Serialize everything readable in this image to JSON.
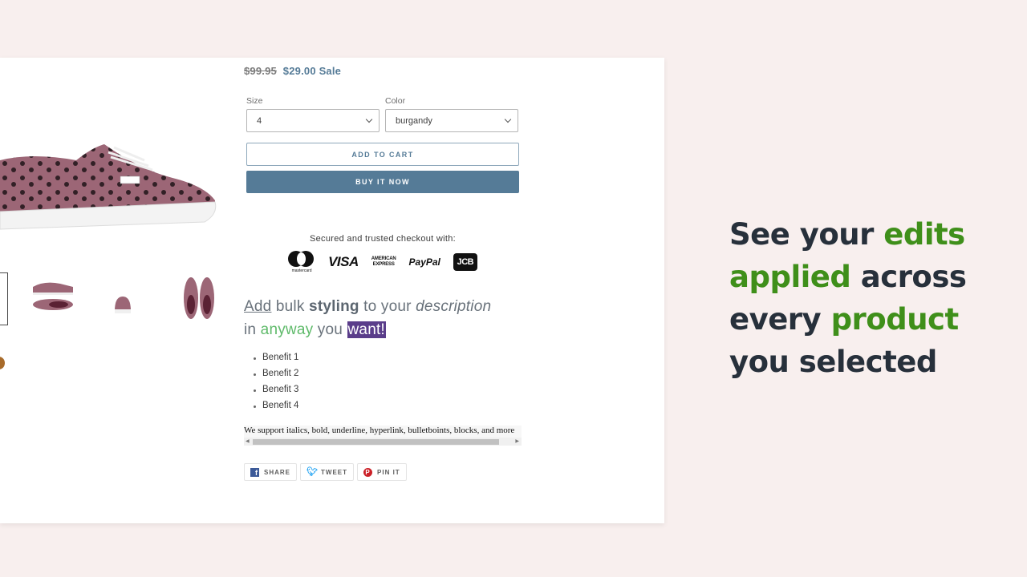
{
  "product": {
    "price_old": "$99.95",
    "price_new": "$29.00",
    "sale_label": "Sale",
    "size": {
      "label": "Size",
      "value": "4"
    },
    "color": {
      "label": "Color",
      "value": "burgandy"
    },
    "add_to_cart_label": "ADD TO CART",
    "buy_now_label": "BUY IT NOW",
    "secure_text": "Secured and trusted checkout with:",
    "payment_methods": [
      "mastercard",
      "VISA",
      "AMERICAN EXPRESS",
      "PayPal",
      "JCB"
    ],
    "payment_labels": {
      "mastercard": "mastercard",
      "visa": "VISA",
      "amex_top": "AMERICAN",
      "amex_bottom": "EXPRESS",
      "paypal": "PayPal",
      "jcb": "JCB"
    },
    "description": {
      "w1": "Add",
      "w2": " bulk ",
      "w3": "styling",
      "w4": " to your ",
      "w5": "description",
      "w6": "in ",
      "w7": "anyway",
      "w8": " you ",
      "w9": "want!"
    },
    "benefits": [
      "Benefit 1",
      "Benefit 2",
      "Benefit 3",
      "Benefit 4"
    ],
    "support_text": "We support italics, bold, underline, hyperlink, bulletboints, blocks, and more",
    "share": {
      "facebook": "SHARE",
      "twitter": "TWEET",
      "pinterest": "PIN IT"
    }
  },
  "headline": {
    "p1": "See your ",
    "p2": "edits",
    "p3": "applied",
    "p4": " across",
    "p5": "every ",
    "p6": "product",
    "p7": "you selected"
  },
  "colors": {
    "accent": "#557b97",
    "headline_green": "#3f8f1a",
    "highlight_purple": "#5a3d8a",
    "background": "#f8efee"
  }
}
